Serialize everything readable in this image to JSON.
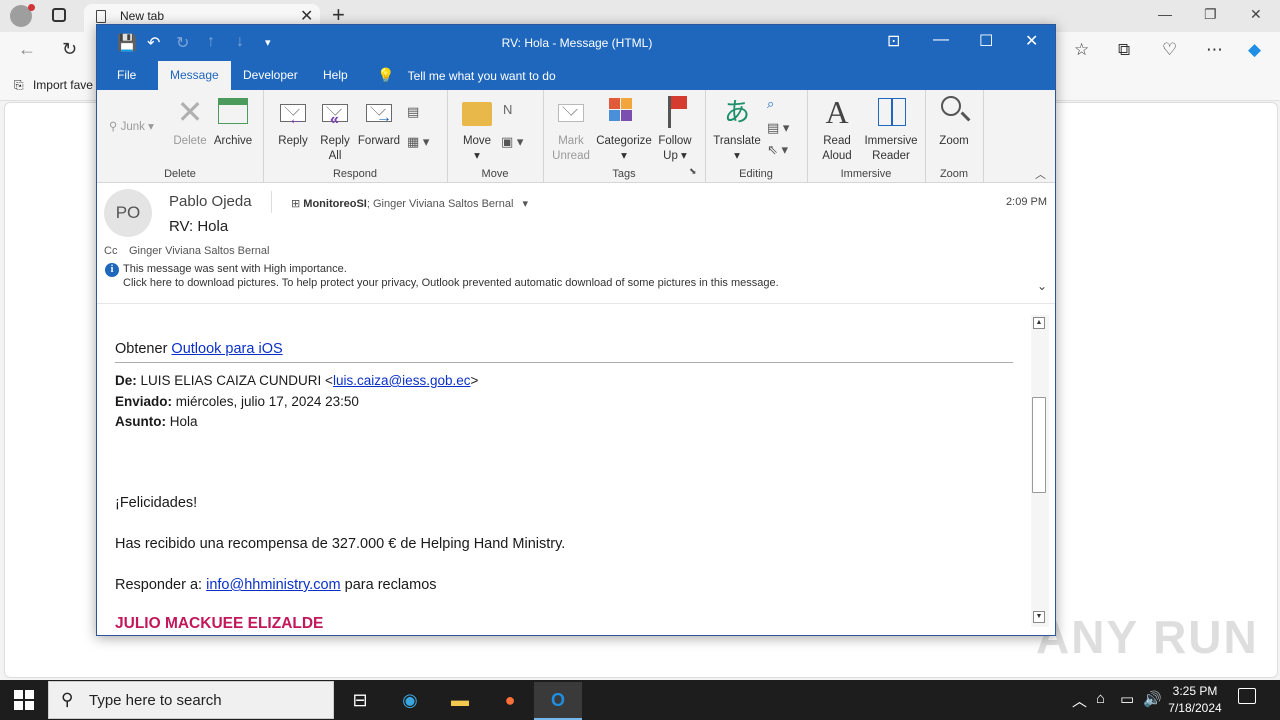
{
  "browser": {
    "tab_title": "New tab",
    "favorites_label": "Import fave",
    "tab_close": "✕",
    "new_tab": "+"
  },
  "outlook": {
    "window_title": "RV: Hola  -  Message (HTML)",
    "tabs": [
      "File",
      "Message",
      "Developer",
      "Help"
    ],
    "tell_me": "Tell me what you want to do",
    "ribbon": {
      "junk": "Junk",
      "delete": "Delete",
      "archive": "Archive",
      "group_delete": "Delete",
      "reply": "Reply",
      "reply_all_1": "Reply",
      "reply_all_2": "All",
      "forward": "Forward",
      "group_respond": "Respond",
      "move": "Move",
      "group_move": "Move",
      "mark_unread_1": "Mark",
      "mark_unread_2": "Unread",
      "categorize": "Categorize",
      "follow_up_1": "Follow",
      "follow_up_2": "Up",
      "group_tags": "Tags",
      "translate": "Translate",
      "group_editing": "Editing",
      "read_aloud_1": "Read",
      "read_aloud_2": "Aloud",
      "immersive_reader_1": "Immersive",
      "immersive_reader_2": "Reader",
      "group_immersive": "Immersive",
      "zoom": "Zoom",
      "group_zoom": "Zoom"
    },
    "header": {
      "avatar_initials": "PO",
      "sender": "Pablo Ojeda",
      "to_primary": "MonitoreoSI",
      "to_secondary": "; Ginger Viviana Saltos Bernal",
      "subject": "RV: Hola",
      "time": "2:09 PM",
      "cc_label": "Cc",
      "cc_name": "Ginger Viviana Saltos Bernal",
      "info_line1": "This message was sent with High importance.",
      "info_line2": "Click here to download pictures. To help protect your privacy, Outlook prevented automatic download of some pictures in this message."
    },
    "body": {
      "obtener": "Obtener ",
      "outlook_ios": "Outlook para iOS",
      "de_label": "De:",
      "de_name": " LUIS ELIAS CAIZA CUNDURI <",
      "de_email": "luis.caiza@iess.gob.ec",
      "de_close": ">",
      "enviado_label": "Enviado:",
      "enviado_value": " miércoles, julio 17, 2024 23:50",
      "asunto_label": "Asunto:",
      "asunto_value": " Hola",
      "felicidades": "¡Felicidades!",
      "recompensa": "Has recibido una recompensa de 327.000 € de Helping Hand Ministry.",
      "responder_prefix": "Responder a: ",
      "responder_email": "info@hhministry.com",
      "responder_suffix": " para reclamos",
      "signature": "JULIO MACKUEE ELIZALDE"
    }
  },
  "taskbar": {
    "search_placeholder": "Type here to search",
    "time": "3:25 PM",
    "date": "7/18/2024"
  },
  "watermark": "ANY RUN",
  "colors": {
    "outlook_blue": "#1e67bd",
    "link_blue": "#0b30c9",
    "signature_pink": "#c2185b"
  }
}
